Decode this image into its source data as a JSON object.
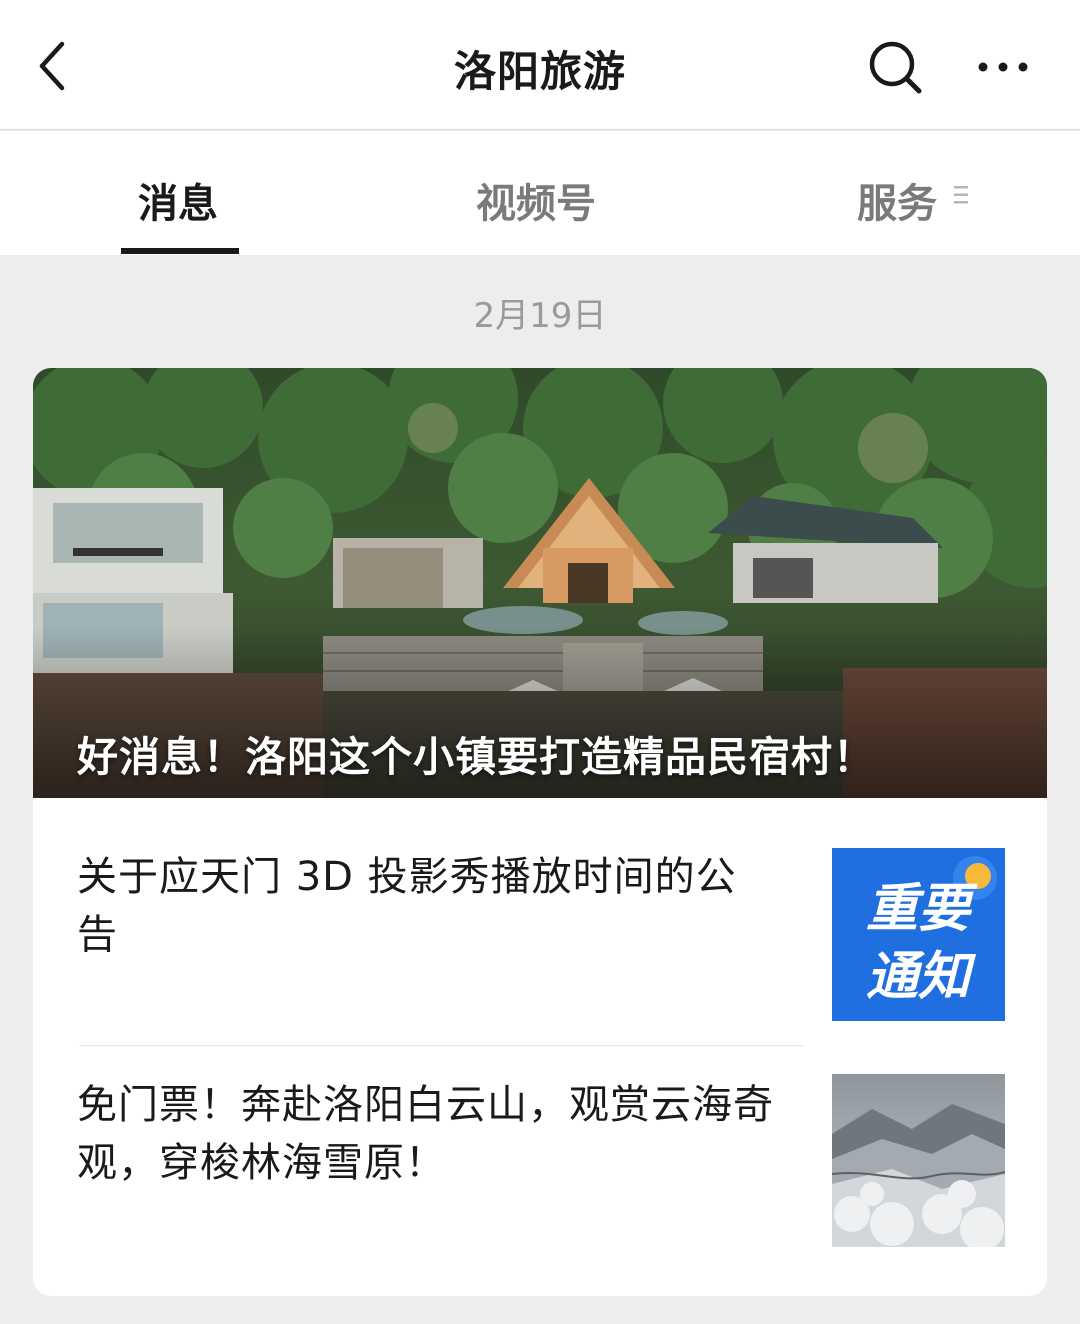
{
  "header": {
    "title": "洛阳旅游",
    "back_icon": "chevron-left-icon",
    "search_icon": "search-icon",
    "more_icon": "more-dots-icon"
  },
  "tabs": [
    {
      "label": "消息",
      "active": true
    },
    {
      "label": "视频号",
      "active": false
    },
    {
      "label": "服务",
      "active": false
    }
  ],
  "feed": {
    "date": "2月19日",
    "hero": {
      "title": "好消息！洛阳这个小镇要打造精品民宿村！",
      "image": "photo of mountain village guesthouses among green trees"
    },
    "articles": [
      {
        "title": "关于应天门 3D 投影秀播放时间的公告",
        "thumb_text_line1": "重要",
        "thumb_text_line2": "通知",
        "thumb_color": "#1e6fdc"
      },
      {
        "title": "免门票！奔赴洛阳白云山，观赏云海奇观，穿梭林海雪原！",
        "thumb": "snowy mountain forest photo"
      }
    ]
  }
}
